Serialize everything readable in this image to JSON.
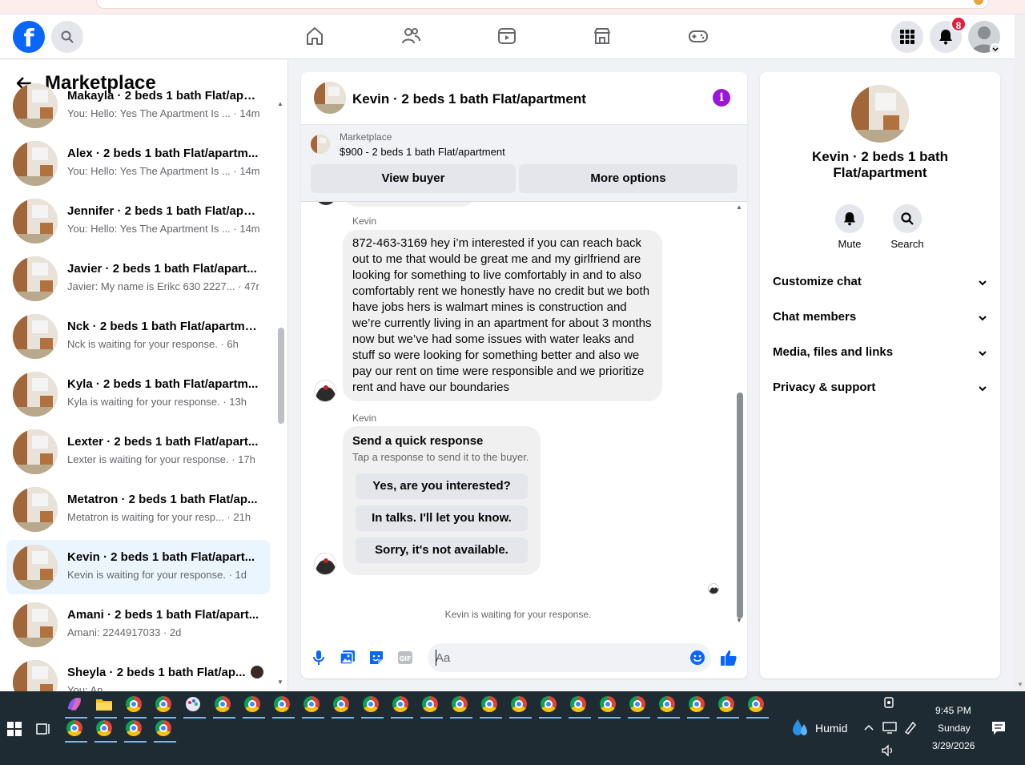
{
  "topnav": {
    "logo": "f",
    "notifications_badge": "8",
    "icons": [
      "home-icon",
      "friends-icon",
      "video-icon",
      "marketplace-icon",
      "gaming-icon"
    ]
  },
  "sidebar": {
    "title": "Marketplace",
    "conversations": [
      {
        "name": "Makayla · 2 beds 1 bath Flat/apa...",
        "preview": "You: Hello: Yes The Apartment Is ... · 14m"
      },
      {
        "name": "Alex · 2 beds 1 bath Flat/apartm...",
        "preview": "You: Hello: Yes The Apartment Is ... · 14m"
      },
      {
        "name": "Jennifer · 2 beds 1 bath Flat/apa...",
        "preview": "You: Hello: Yes The Apartment Is ... · 14m"
      },
      {
        "name": "Javier · 2 beds 1 bath Flat/apart...",
        "preview": "Javier: My name is Erikc 630 2227... · 47m"
      },
      {
        "name": "Nck · 2 beds 1 bath Flat/apartme...",
        "preview": "Nck is waiting for your response. · 6h"
      },
      {
        "name": "Kyla · 2 beds 1 bath Flat/apartm...",
        "preview": "Kyla is waiting for your response. · 13h"
      },
      {
        "name": "Lexter · 2 beds 1 bath Flat/apart...",
        "preview": "Lexter is waiting for your response. · 17h"
      },
      {
        "name": "Metatron · 2 beds 1 bath Flat/ap...",
        "preview": "Metatron is waiting for your resp... · 21h"
      },
      {
        "name": "Kevin · 2 beds 1 bath Flat/apart...",
        "preview": "Kevin is waiting for your response. · 1d"
      },
      {
        "name": "Amani · 2 beds 1 bath Flat/apart...",
        "preview": "Amani: 2244917033 · 2d"
      },
      {
        "name": "Sheyla · 2 beds 1 bath Flat/ap...",
        "preview": "You: Ap..."
      }
    ]
  },
  "chat": {
    "title": "Kevin · 2 beds 1 bath Flat/apartment",
    "listing": {
      "source": "Marketplace",
      "price_title": "$900 - 2 beds 1 bath Flat/apartment",
      "view_buyer": "View buyer",
      "more_options": "More options"
    },
    "messages": [
      {
        "sender": "Kevin",
        "text": "872-463-3169 hey i’m interested if you can reach back out to me that would be great me and my girlfriend are looking for something to live comfortably in and to also comfortably rent we honestly have no credit but we both have jobs hers is walmart mines is construction and we’re currently living in an apartment for about 3 months now but we’ve had some issues with water leaks and stuff so were looking for something better and also we pay our rent on time were responsible and we prioritize rent and have our boundaries"
      }
    ],
    "quick_response": {
      "sender": "Kevin",
      "title": "Send a quick response",
      "subtitle": "Tap a response to send it to the buyer.",
      "options": [
        "Yes, are you interested?",
        "In talks. I'll let you know.",
        "Sorry, it's not available."
      ]
    },
    "waiting_text": "Kevin is waiting for your response.",
    "composer": {
      "placeholder": "Aa"
    }
  },
  "info_panel": {
    "name": "Kevin · 2 beds 1 bath Flat/apartment",
    "actions": [
      {
        "label": "Mute",
        "icon": "bell-icon"
      },
      {
        "label": "Search",
        "icon": "search-icon"
      }
    ],
    "sections": [
      "Customize chat",
      "Chat members",
      "Media, files and links",
      "Privacy & support"
    ]
  },
  "taskbar": {
    "weather": "Humid",
    "time": "9:45 PM",
    "day": "Sunday",
    "date": "3/29/2026"
  },
  "colors": {
    "facebook_blue": "#0866ff",
    "info_purple": "#9b16d9",
    "badge_red": "#e41e3f",
    "active_row": "#ebf5ff",
    "taskbar": "#1f2b33"
  }
}
